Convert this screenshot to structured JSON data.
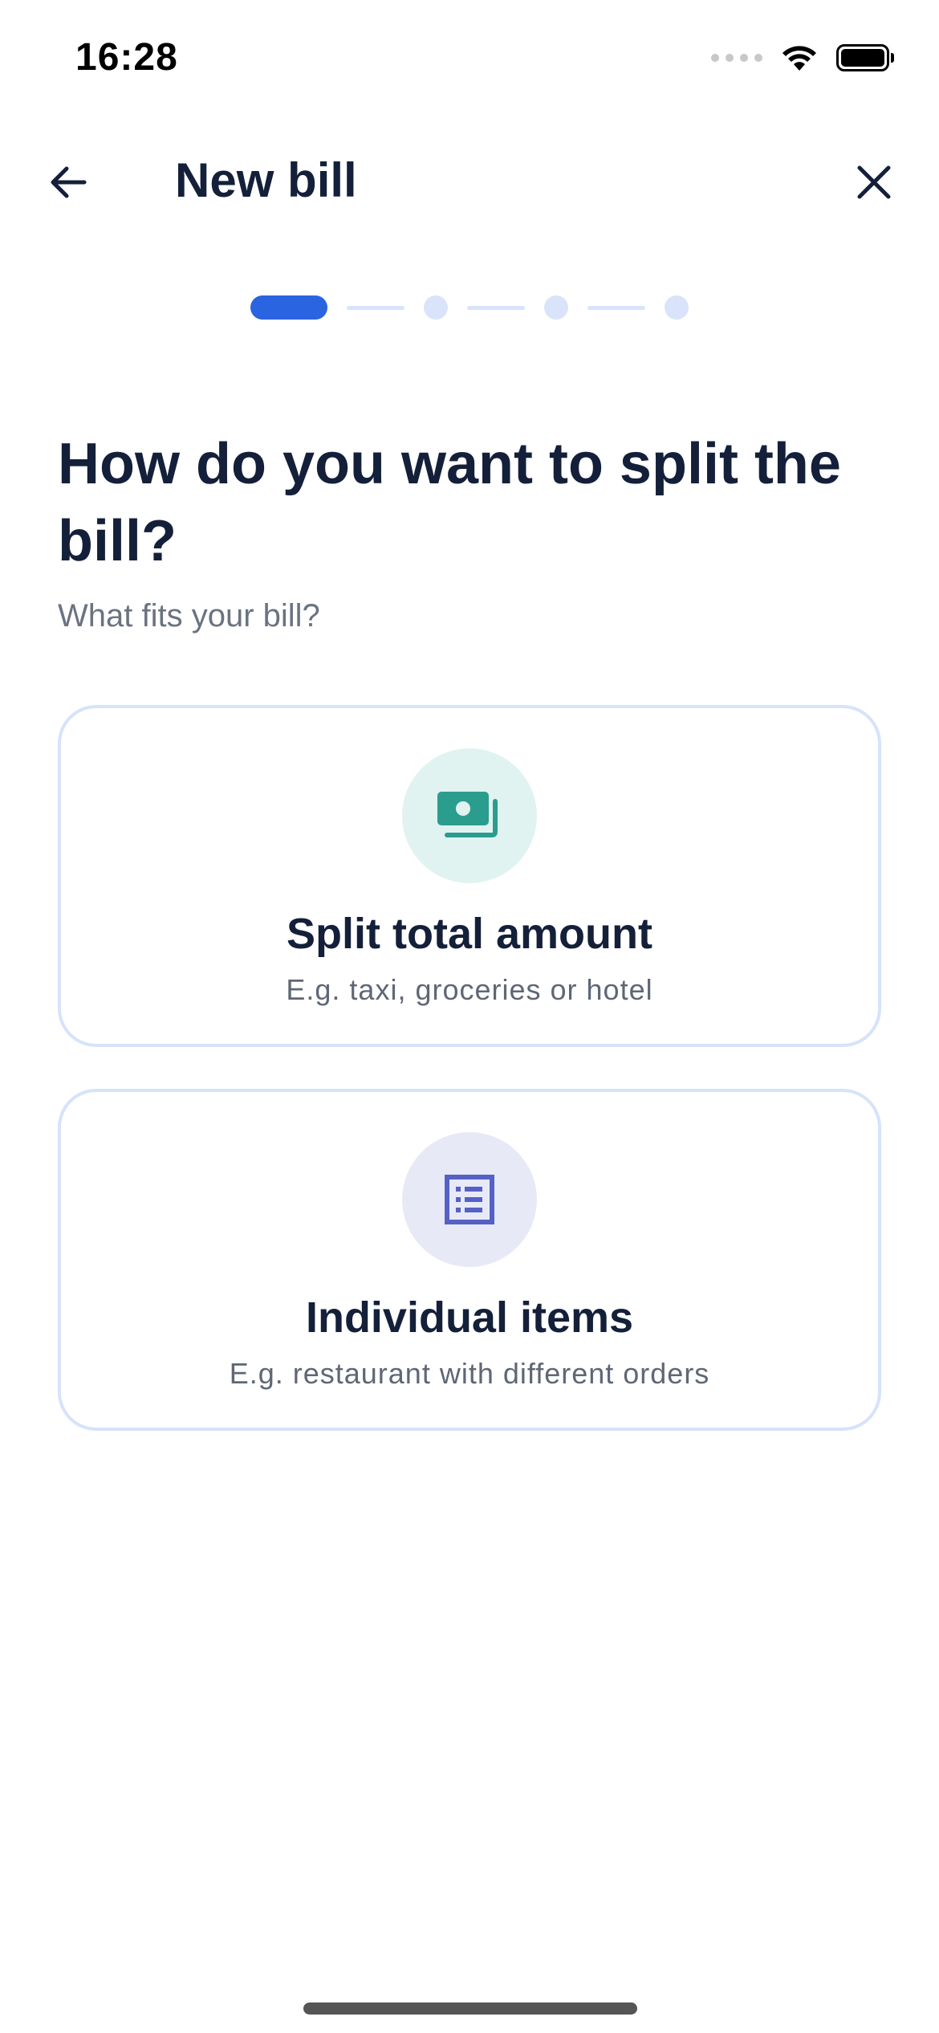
{
  "status_bar": {
    "time": "16:28"
  },
  "header": {
    "title": "New bill",
    "back_icon": "arrow-left-icon",
    "close_icon": "close-icon"
  },
  "stepper": {
    "total_steps": 4,
    "current_step": 1
  },
  "main": {
    "heading": "How do you want to split the bill?",
    "subheading": "What fits your bill?"
  },
  "options": [
    {
      "title": "Split total amount",
      "description": "E.g. taxi, groceries or hotel",
      "icon": "cash-icon",
      "icon_color": "#2a9d8f",
      "icon_bg": "#e0f3f0"
    },
    {
      "title": "Individual items",
      "description": "E.g. restaurant with different orders",
      "icon": "list-icon",
      "icon_color": "#5561c4",
      "icon_bg": "#e7e9f7"
    }
  ],
  "colors": {
    "accent": "#2b64e0",
    "step_inactive": "#d9e4fa",
    "card_border": "#d6e3fa",
    "text_primary": "#14203a",
    "text_secondary": "#6b7380"
  }
}
